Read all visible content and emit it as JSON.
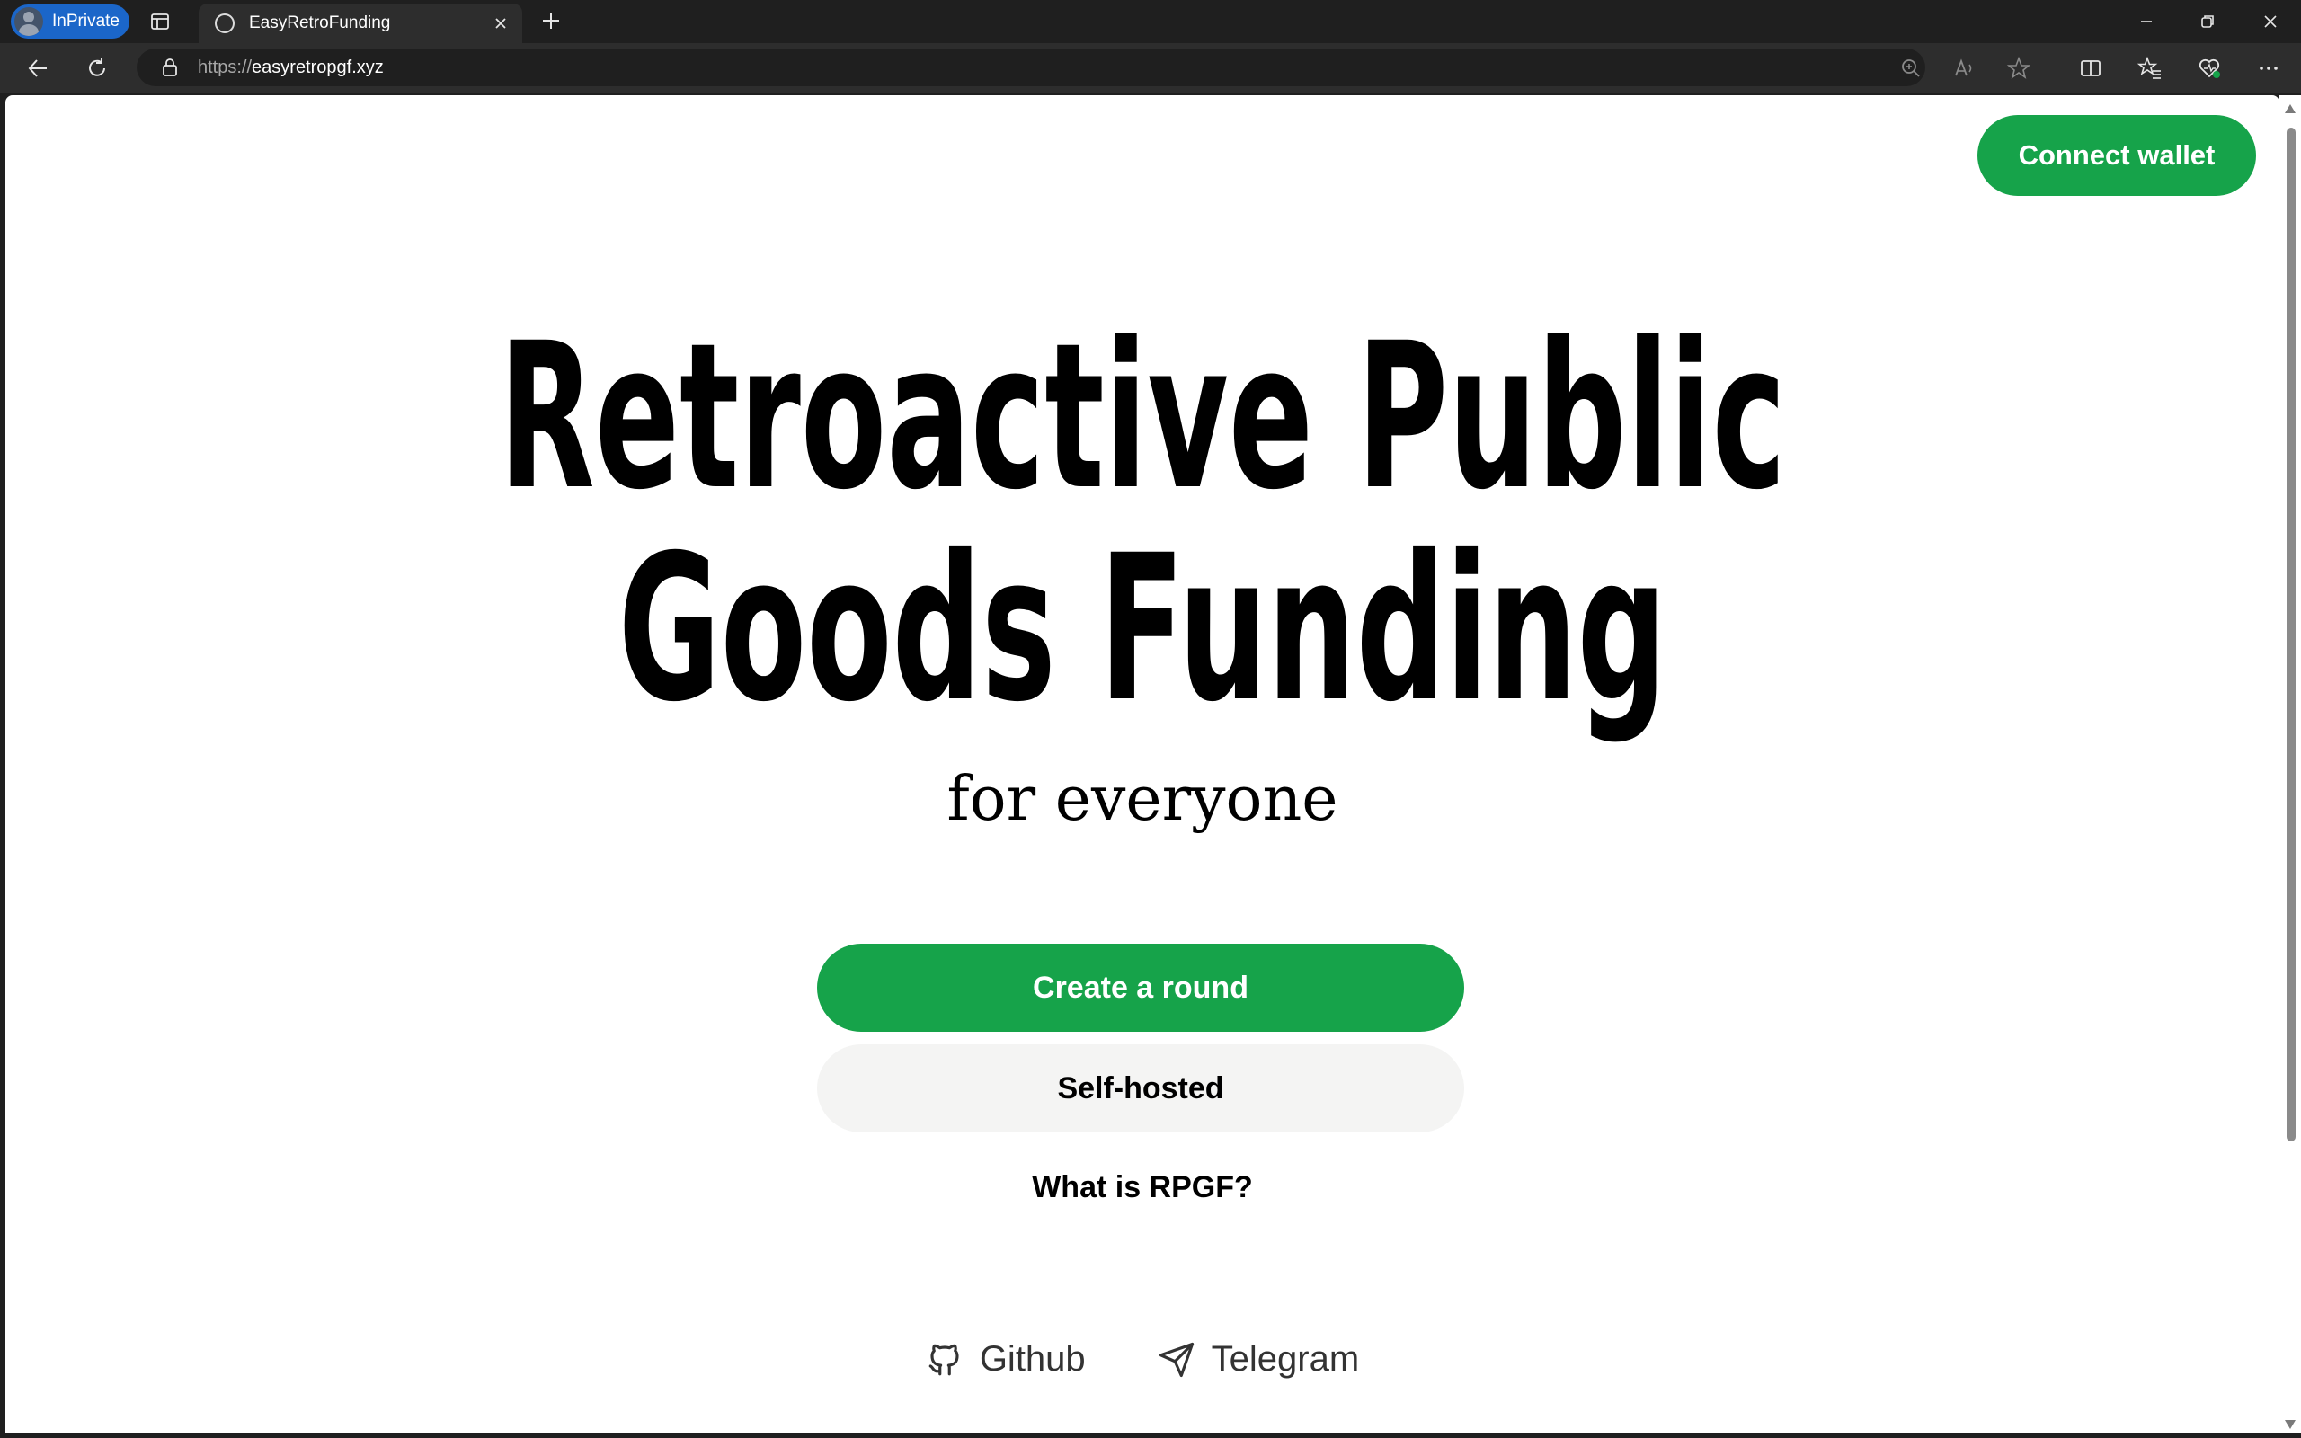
{
  "browser": {
    "profile_label": "InPrivate",
    "tab_title": "EasyRetroFunding",
    "url_prefix": "https://",
    "url_host": "easyretropgf.xyz"
  },
  "page": {
    "connect_wallet": "Connect wallet",
    "hero_line1": "Retroactive Public",
    "hero_line2": "Goods Funding",
    "subtitle": "for everyone",
    "create_round": "Create a round",
    "self_hosted": "Self-hosted",
    "what_is": "What is RPGF?",
    "footer_links": [
      "Github",
      "Telegram"
    ]
  },
  "colors": {
    "accent_green": "#16a34a",
    "inprivate_blue": "#1b66c9",
    "secondary_button": "#f4f4f3"
  },
  "icons": [
    "inprivate-avatar-icon",
    "tab-actions-icon",
    "favicon-icon",
    "close-tab-icon",
    "new-tab-icon",
    "minimize-icon",
    "restore-icon",
    "close-window-icon",
    "back-icon",
    "refresh-icon",
    "lock-icon",
    "zoom-icon",
    "read-aloud-icon",
    "favorite-star-icon",
    "split-screen-icon",
    "favorites-icon",
    "browser-essentials-icon",
    "more-icon",
    "github-icon",
    "telegram-icon"
  ]
}
